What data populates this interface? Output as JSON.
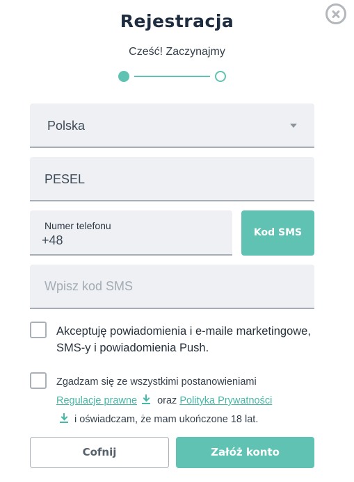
{
  "header": {
    "title": "Rejestracja",
    "subtitle": "Cześć! Zaczynajmy",
    "close_icon": "close-circle-icon",
    "step": {
      "current": 1,
      "total": 2
    }
  },
  "form": {
    "country": {
      "value": "Polska",
      "icon": "caret-down-icon"
    },
    "pesel": {
      "placeholder": "PESEL"
    },
    "phone": {
      "label": "Numer telefonu",
      "prefix": "+48"
    },
    "sms_button": "Kod SMS",
    "sms_code": {
      "placeholder": "Wpisz kod SMS"
    }
  },
  "consents": {
    "marketing": {
      "checked": false,
      "text": "Akceptuję powiadomienia i e-maile marketingowe, SMS-y i powiadomienia Push."
    },
    "terms": {
      "checked": false,
      "prefix": "Zgadzam się ze wszystkimi postanowieniami",
      "regulations_link": "Regulacje prawne",
      "connector": "oraz",
      "privacy_link": "Polityka Prywatności",
      "suffix": "i oświadczam, że mam ukończone 18 lat.",
      "download_icon": "download-icon"
    }
  },
  "actions": {
    "back": "Cofnij",
    "create": "Załóż konto"
  },
  "colors": {
    "accent": "#5fc2b3",
    "link": "#45b8a7",
    "field_bg": "#eef0f3",
    "title": "#1e2c40"
  }
}
